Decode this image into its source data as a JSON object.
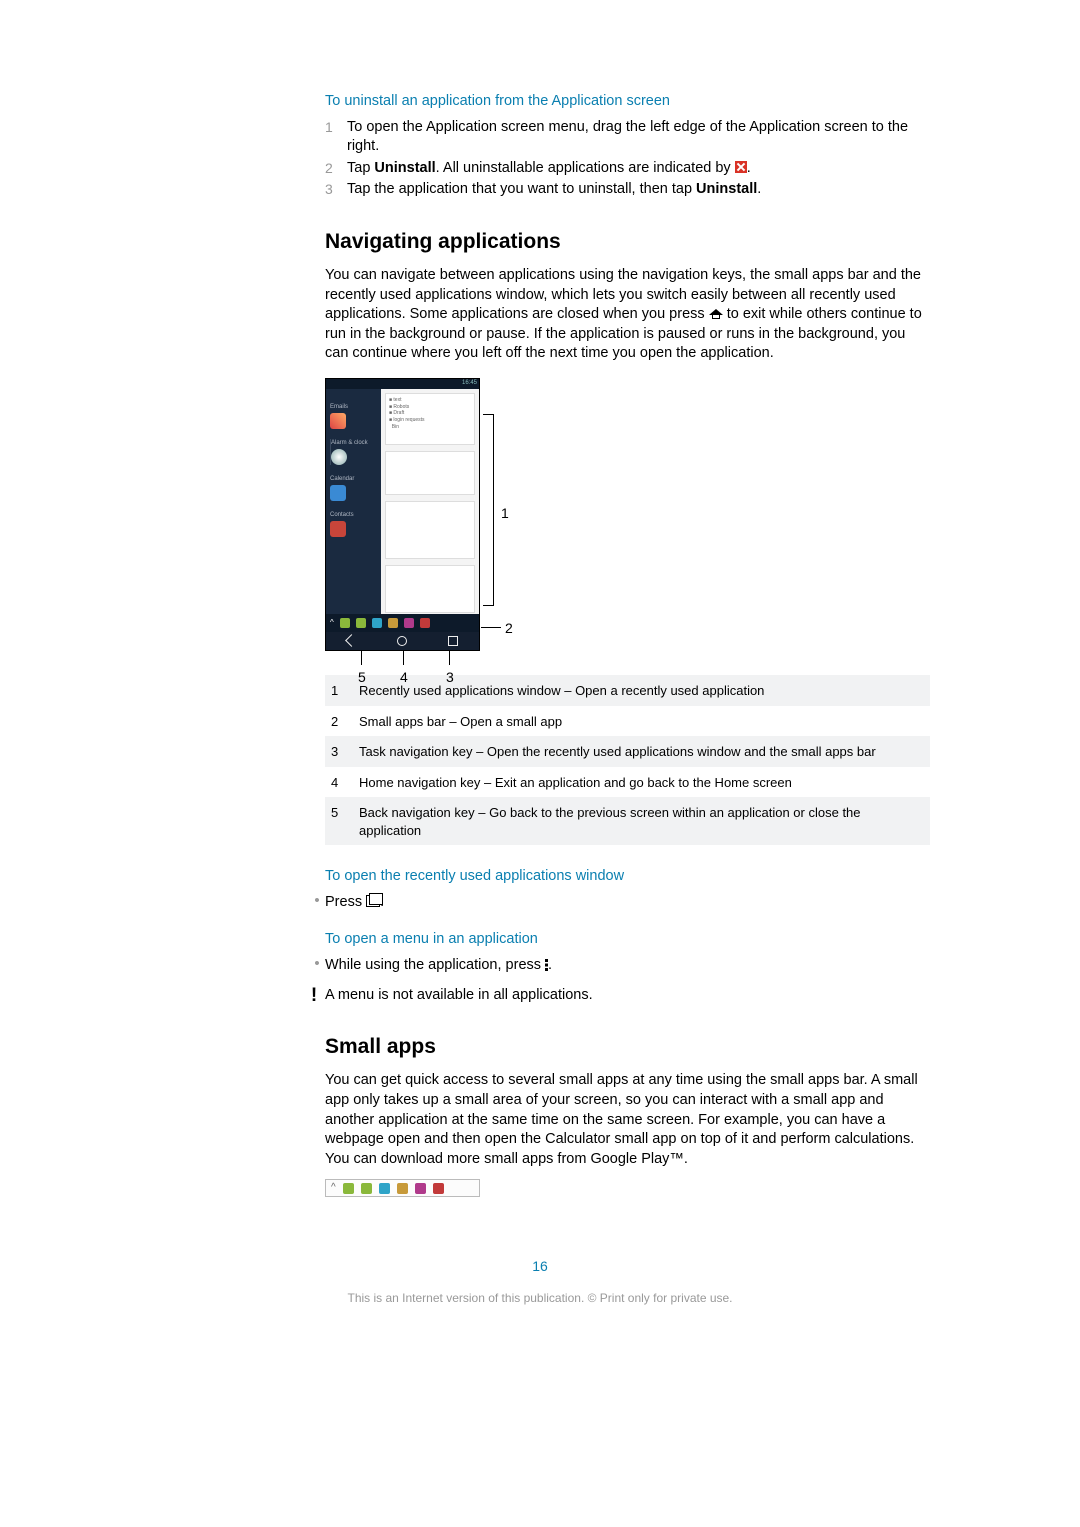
{
  "sec1": {
    "subhead": "To uninstall an application from the Application screen",
    "steps": [
      {
        "n": "1",
        "text": "To open the Application screen menu, drag the left edge of the Application screen to the right."
      },
      {
        "n": "2",
        "pre": "Tap ",
        "b": "Uninstall",
        "post": ". All uninstallable applications are indicated by "
      },
      {
        "n": "3",
        "pre": "Tap the application that you want to uninstall, then tap ",
        "b": "Uninstall",
        "post": "."
      }
    ]
  },
  "nav": {
    "heading": "Navigating applications",
    "para_pre": "You can navigate between applications using the navigation keys, the small apps bar and the recently used applications window, which lets you switch easily between all recently used applications. Some applications are closed when you press ",
    "para_post": " to exit while others continue to run in the background or pause. If the application is paused or runs in the background, you can continue where you left off the next time you open the application."
  },
  "figure": {
    "status_time": "16:45",
    "left_apps": [
      "Emails",
      "Alarm & clock",
      "Calendar",
      "Contacts"
    ],
    "labels": {
      "c1": "1",
      "c2": "2",
      "c3": "3",
      "c4": "4",
      "c5": "5"
    },
    "small_app_colors": [
      "#8ab83b",
      "#8ab83b",
      "#2fa4c8",
      "#c79a3a",
      "#b03a8b",
      "#c23a3a"
    ]
  },
  "legend": [
    {
      "n": "1",
      "t": "Recently used applications window – Open a recently used application"
    },
    {
      "n": "2",
      "t": "Small apps bar – Open a small app"
    },
    {
      "n": "3",
      "t": "Task navigation key – Open the recently used applications window and the small apps bar"
    },
    {
      "n": "4",
      "t": "Home navigation key – Exit an application and go back to the Home screen"
    },
    {
      "n": "5",
      "t": "Back navigation key – Go back to the previous screen within an application or close the application"
    }
  ],
  "recent": {
    "subhead": "To open the recently used applications window",
    "bullet_pre": "Press ",
    "bullet_post": "."
  },
  "menu": {
    "subhead": "To open a menu in an application",
    "bullet_pre": "While using the application, press ",
    "bullet_post": ".",
    "warn": "A menu is not available in all applications."
  },
  "small": {
    "heading": "Small apps",
    "para": "You can get quick access to several small apps at any time using the small apps bar. A small app only takes up a small area of your screen, so you can interact with a small app and another application at the same time on the same screen. For example, you can have a webpage open and then open the Calculator small app on top of it and perform calculations. You can download more small apps from Google Play™.",
    "bar_colors": [
      "#8ab83b",
      "#8ab83b",
      "#2fa4c8",
      "#c79a3a",
      "#b03a8b",
      "#c23a3a"
    ]
  },
  "page_number": "16",
  "footer": "This is an Internet version of this publication. © Print only for private use."
}
